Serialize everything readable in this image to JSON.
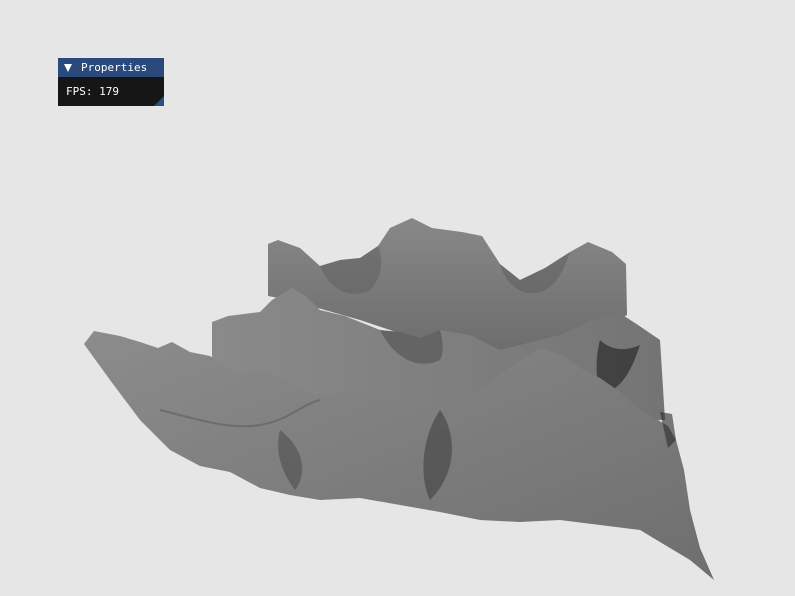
{
  "window": {
    "background_color": "#e6e6e6"
  },
  "properties_panel": {
    "title": "Properties",
    "title_bar_color": "#294a7a",
    "body_color": "#161616",
    "collapse_icon": "triangle-down-icon",
    "fps_label": "FPS:",
    "fps_value": "179"
  },
  "scene": {
    "object": "terrain-mesh",
    "surface_color": "#7b7b7b"
  }
}
